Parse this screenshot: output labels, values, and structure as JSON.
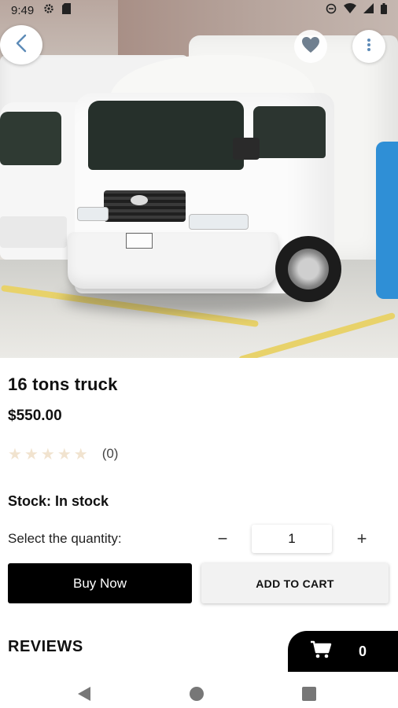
{
  "status_bar": {
    "time": "9:49",
    "left_icons": [
      "gear-icon",
      "sd-card-icon"
    ],
    "right_icons": [
      "do-not-disturb-icon",
      "wifi-icon",
      "signal-icon",
      "battery-icon"
    ]
  },
  "header": {
    "back_icon": "chevron-left-icon",
    "favorite_icon": "heart-icon",
    "more_icon": "more-vertical-icon"
  },
  "product": {
    "name": "16 tons truck",
    "price": "$550.00",
    "rating": {
      "stars_filled": 0,
      "stars_total": 5,
      "count_text": "(0)"
    },
    "stock_label": "Stock:",
    "stock_value": "In stock"
  },
  "quantity": {
    "label": "Select the quantity:",
    "minus": "−",
    "value": "1",
    "plus": "+"
  },
  "actions": {
    "buy_now": "Buy Now",
    "add_to_cart": "ADD TO CART"
  },
  "reviews": {
    "heading": "REVIEWS"
  },
  "cart": {
    "icon": "cart-icon",
    "count": "0"
  },
  "nav_bar": {
    "icons": [
      "nav-back-icon",
      "nav-home-icon",
      "nav-recents-icon"
    ]
  },
  "colors": {
    "primary": "#000000",
    "star_empty": "#f1e3cf",
    "secondary_button": "#f2f2f2"
  }
}
